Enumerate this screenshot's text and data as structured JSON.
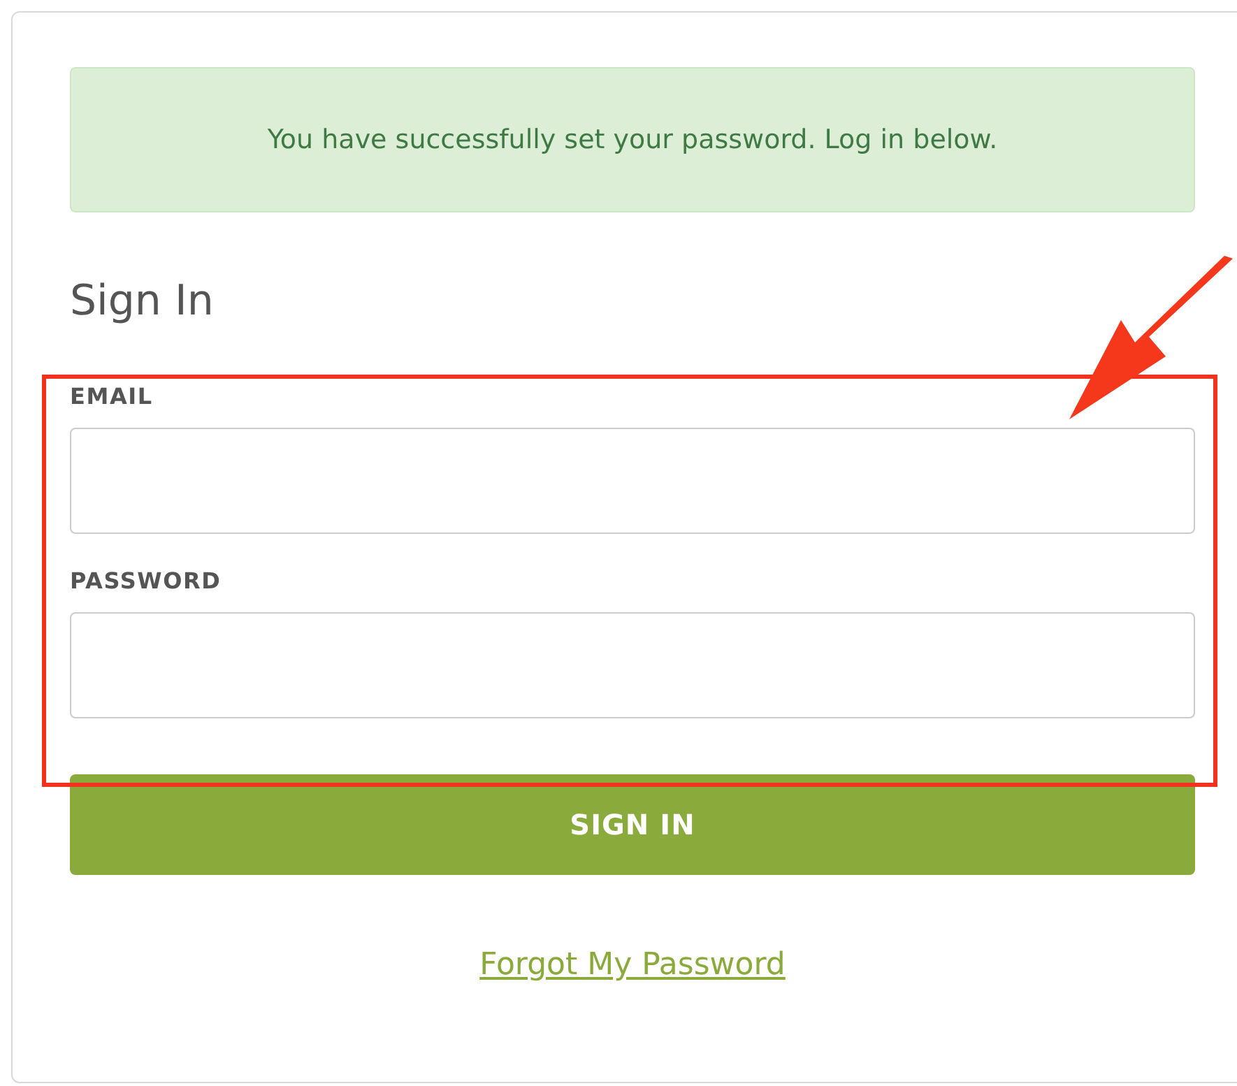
{
  "alert": {
    "message": "You have successfully set your password. Log in below."
  },
  "heading": "Sign In",
  "fields": [
    {
      "label": "EMAIL"
    },
    {
      "label": "PASSWORD"
    }
  ],
  "button": "SIGN IN",
  "link": "Forgot My Password"
}
